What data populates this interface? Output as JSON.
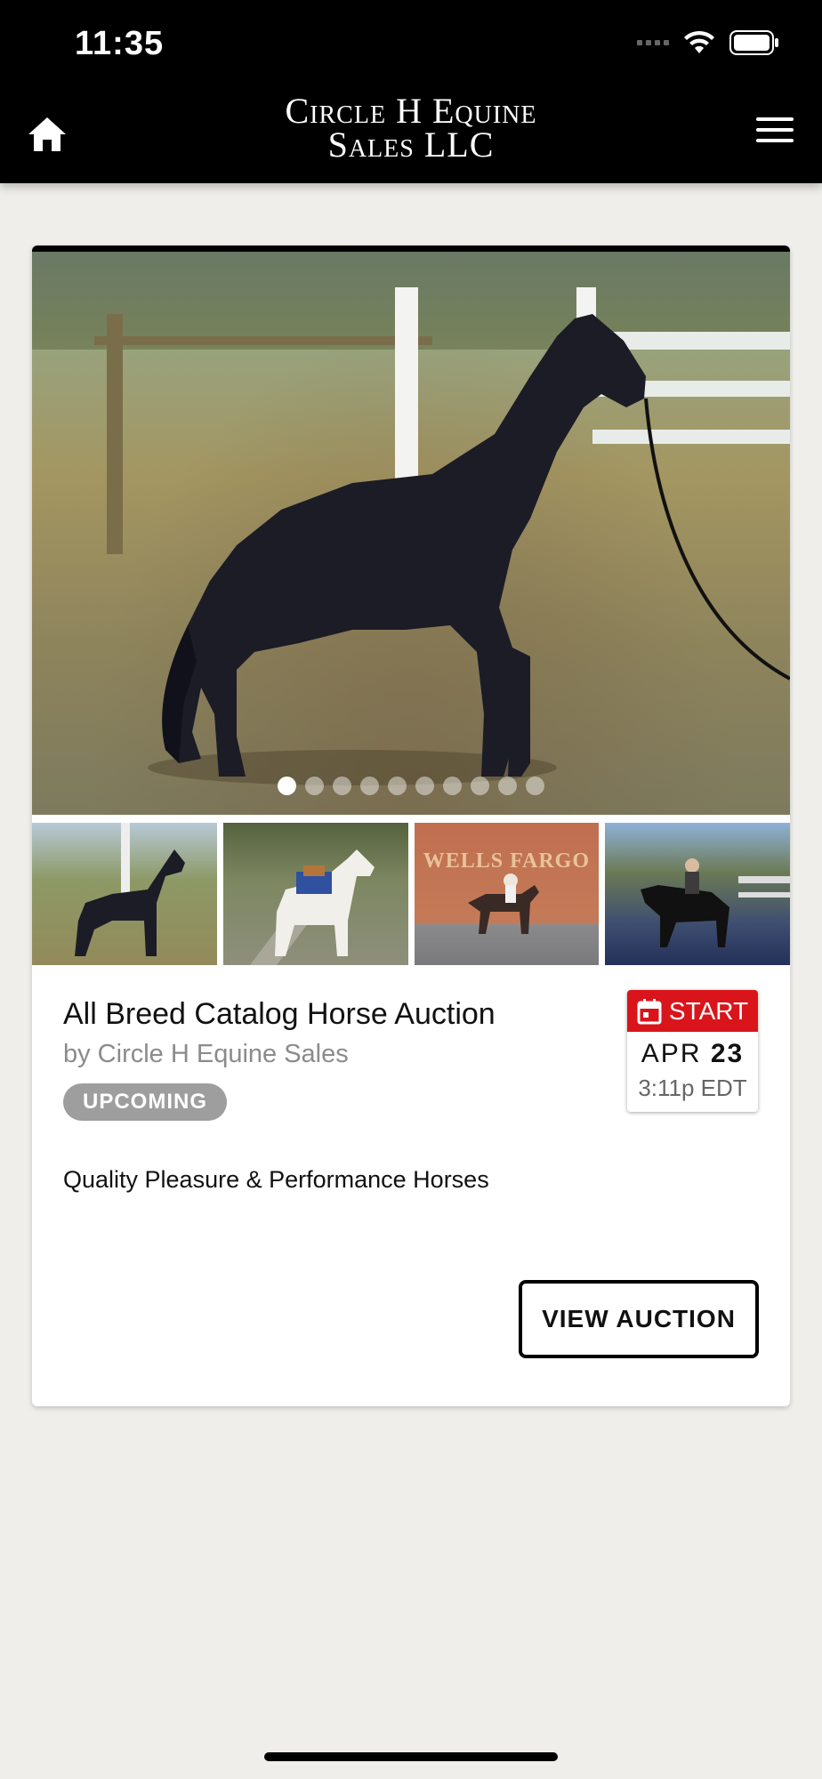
{
  "status_bar": {
    "time": "11:35"
  },
  "header": {
    "brand_line1": "Circle H Equine",
    "brand_line2": "Sales LLC"
  },
  "gallery": {
    "image_count": 10,
    "active_index": 0,
    "thumbnails": [
      {
        "name": "thumb-horse-black-pasture",
        "caption": ""
      },
      {
        "name": "thumb-horse-spotted-saddle",
        "caption": ""
      },
      {
        "name": "thumb-horse-wells-fargo",
        "caption": "WELLS FARGO"
      },
      {
        "name": "thumb-horse-rider-parking",
        "caption": ""
      }
    ]
  },
  "auction": {
    "title": "All Breed Catalog Horse Auction",
    "byline": "by Circle H Equine Sales",
    "status": "UPCOMING",
    "description": "Quality Pleasure & Performance Horses",
    "start_label": "START",
    "month": "APR",
    "day": "23",
    "time": "3:11p EDT",
    "button_label": "VIEW AUCTION"
  },
  "colors": {
    "header_bg": "#000000",
    "page_bg": "#efeeea",
    "start_red": "#d9141b",
    "badge_gray": "#9e9e9e"
  }
}
